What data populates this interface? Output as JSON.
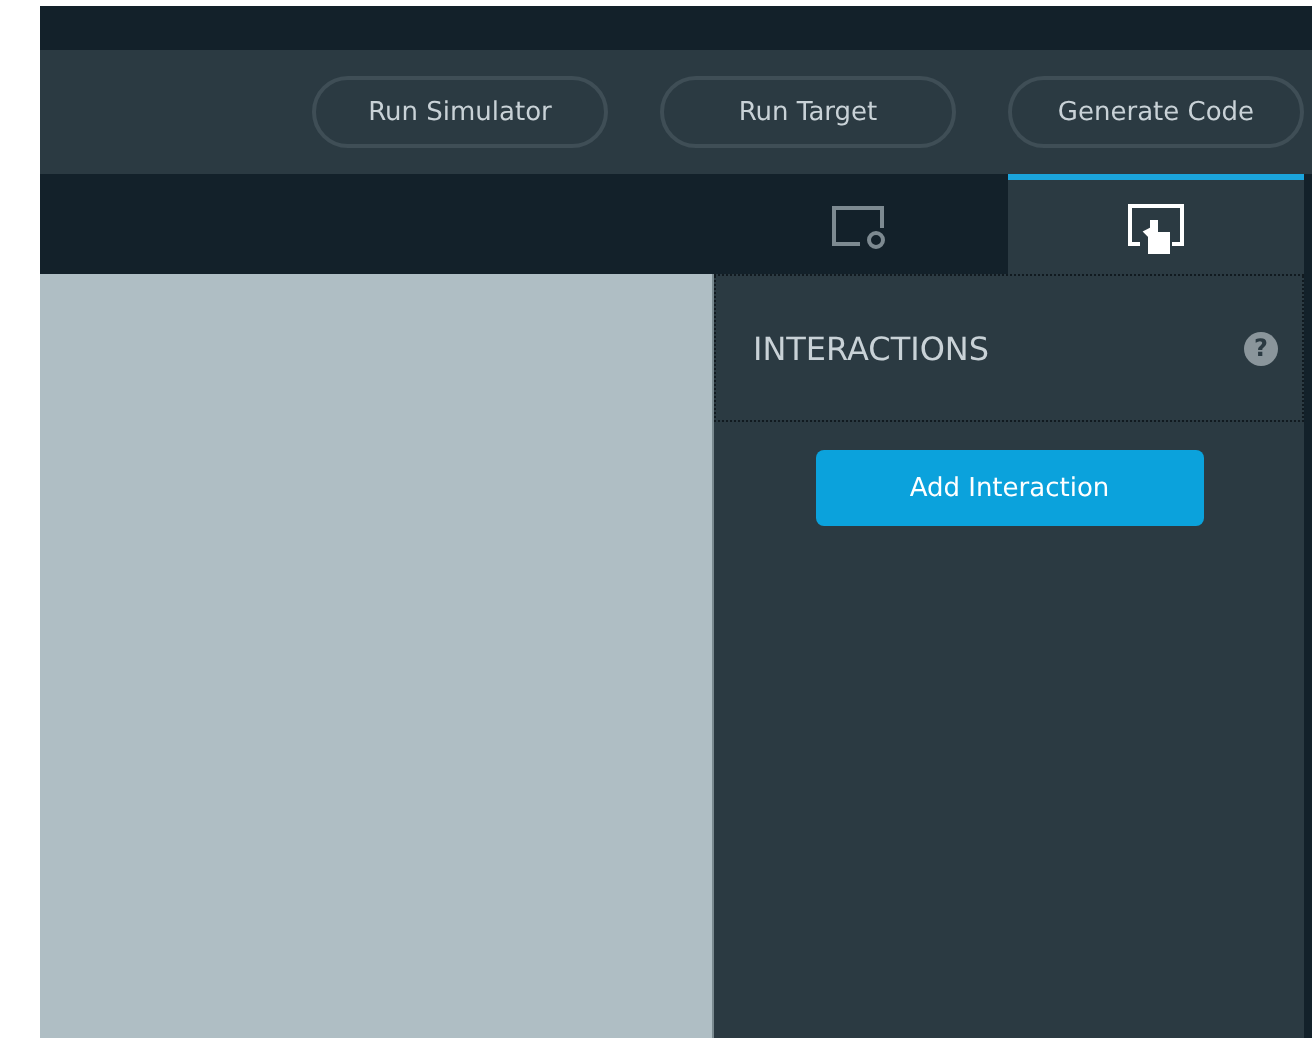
{
  "toolbar": {
    "buttons": [
      "Run Simulator",
      "Run Target",
      "Generate Code"
    ]
  },
  "tabs": [
    {
      "kind": "screen-settings",
      "selected": false
    },
    {
      "kind": "interaction",
      "selected": true
    }
  ],
  "panel": {
    "title": "INTERACTIONS",
    "help": "?",
    "button": "Add Interaction"
  }
}
